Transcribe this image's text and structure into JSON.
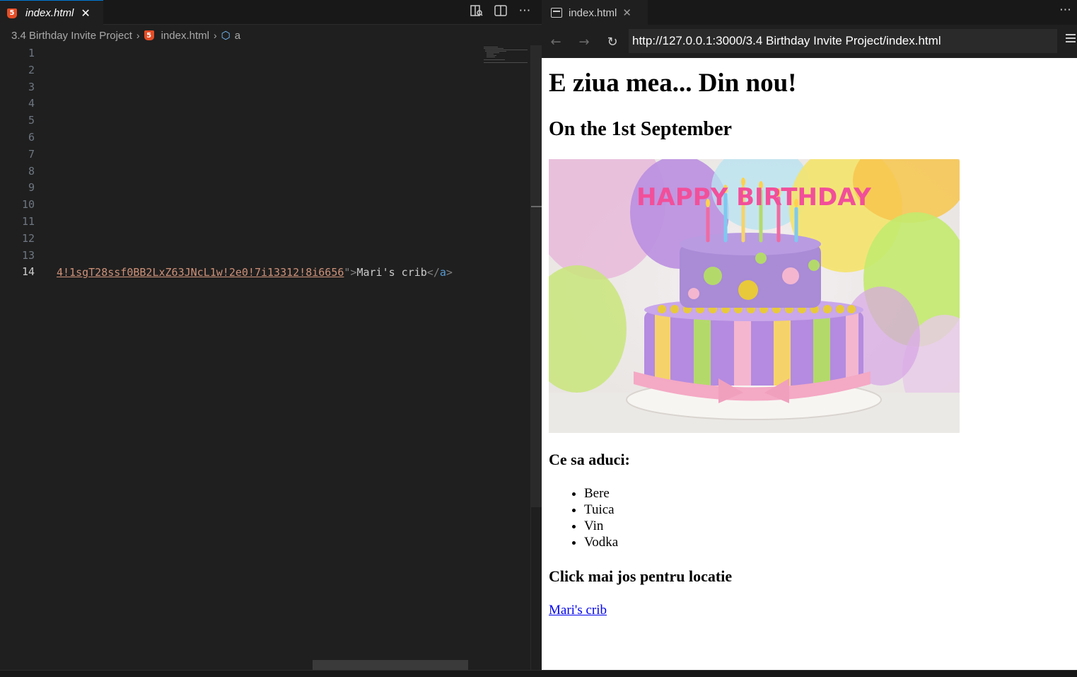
{
  "editor": {
    "tab": {
      "title": "index.html",
      "icon": "html5-icon"
    },
    "breadcrumb": {
      "folder": "3.4 Birthday Invite Project",
      "file": "index.html",
      "symbol": "a"
    },
    "line_numbers": [
      "1",
      "2",
      "3",
      "4",
      "5",
      "6",
      "7",
      "8",
      "9",
      "10",
      "11",
      "12",
      "13",
      "14"
    ],
    "active_line": "14",
    "code": {
      "url_tail": "4!1sgT28ssf0BB2LxZ63JNcL1w!2e0!7i13312!8i6656",
      "quote_close": "\">",
      "link_text": "Mari's crib",
      "close_tag_open": "</",
      "close_tag_name": "a",
      "close_tag_end": ">"
    }
  },
  "browser": {
    "tab": {
      "title": "index.html"
    },
    "url": "http://127.0.0.1:3000/3.4 Birthday Invite Project/index.html",
    "page": {
      "h1": "E ziua mea... Din nou!",
      "h2": "On the 1st September",
      "image_label": "HAPPY BIRTHDAY",
      "bring_heading": "Ce sa aduci:",
      "bring_items": [
        "Bere",
        "Tuica",
        "Vin",
        "Vodka"
      ],
      "location_heading": "Click mai jos pentru locatie",
      "link_text": "Mari's crib"
    }
  },
  "colors": {
    "editor_bg": "#1f1f1f",
    "string": "#ce9178",
    "tag": "#569cd6",
    "accent": "#0078d4",
    "link": "#0000ee"
  }
}
